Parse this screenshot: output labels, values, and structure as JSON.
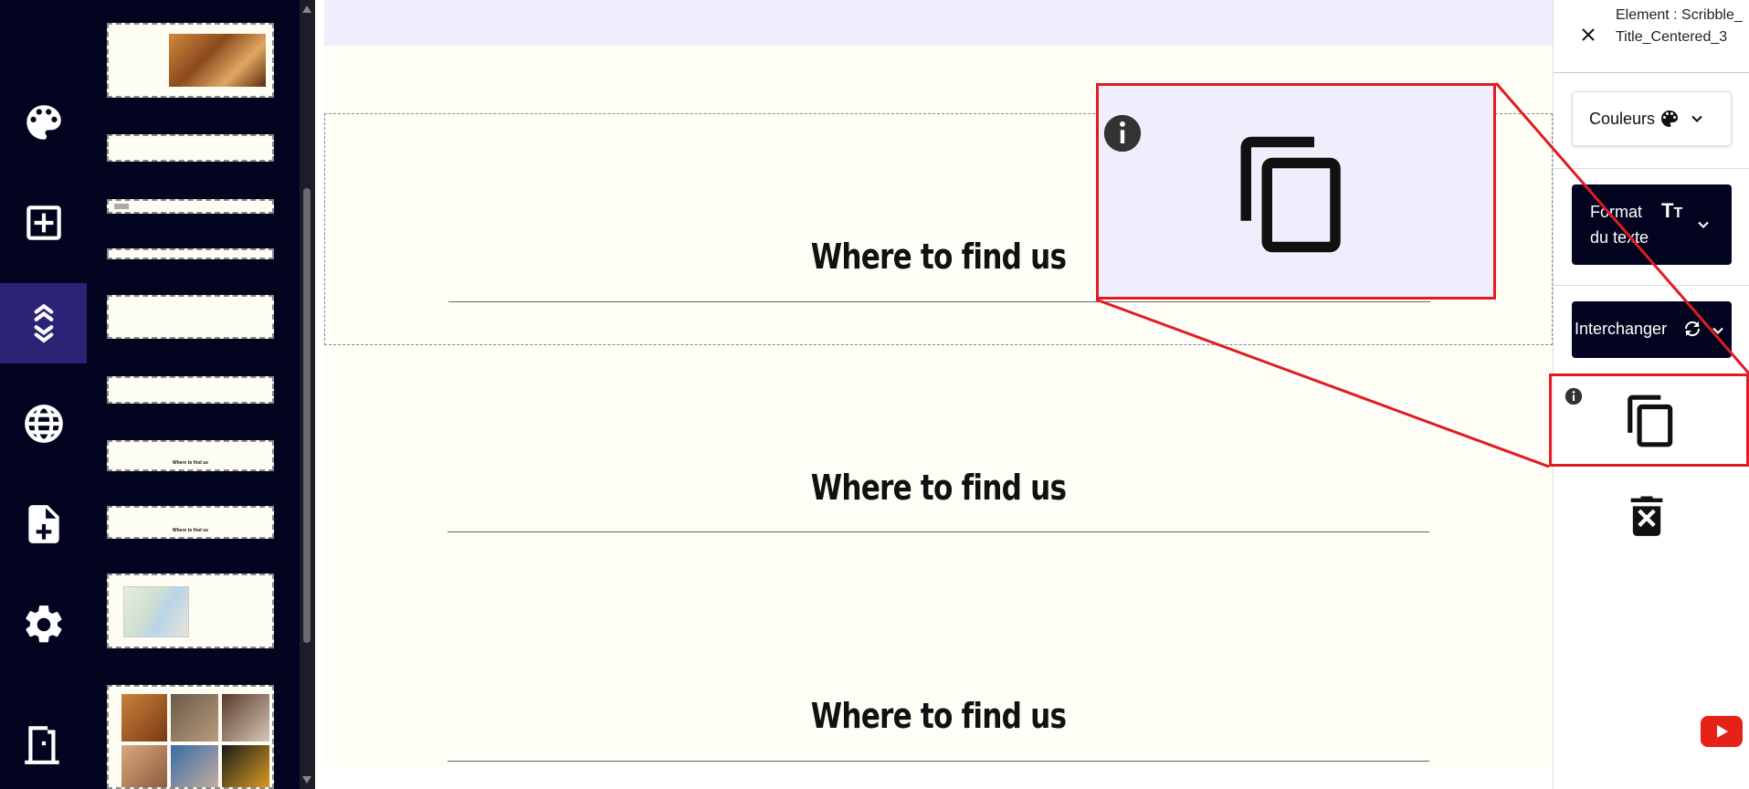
{
  "rail": {
    "items": [
      {
        "name": "palette-icon"
      },
      {
        "name": "add-box-icon"
      },
      {
        "name": "reorder-icon",
        "active": true
      },
      {
        "name": "globe-icon"
      },
      {
        "name": "add-page-icon"
      },
      {
        "name": "gear-icon"
      },
      {
        "name": "exit-door-icon"
      }
    ]
  },
  "thumbnails": {
    "items": [
      {
        "kind": "hero-image"
      },
      {
        "kind": "blank"
      },
      {
        "kind": "small-tag"
      },
      {
        "kind": "blank-thin"
      },
      {
        "kind": "blank"
      },
      {
        "kind": "blank"
      },
      {
        "kind": "title",
        "text": "Where to find us"
      },
      {
        "kind": "title",
        "text": "Where to find us"
      },
      {
        "kind": "map"
      },
      {
        "kind": "gallery"
      }
    ]
  },
  "canvas": {
    "sections": [
      {
        "title": "Where to find us",
        "selected": true
      },
      {
        "title": "Where to find us",
        "selected": false
      },
      {
        "title": "Where to find us",
        "selected": false
      }
    ]
  },
  "panel": {
    "element_label": "Element : Scribble_Title_Centered_3",
    "colors_label": "Couleurs",
    "text_format_label": "Format du texte",
    "swap_label": "Interchanger"
  },
  "colors": {
    "rail_bg": "#03041f",
    "rail_active": "#2c2377",
    "accent_red": "#e01b24",
    "page_bg": "#fefef6"
  }
}
